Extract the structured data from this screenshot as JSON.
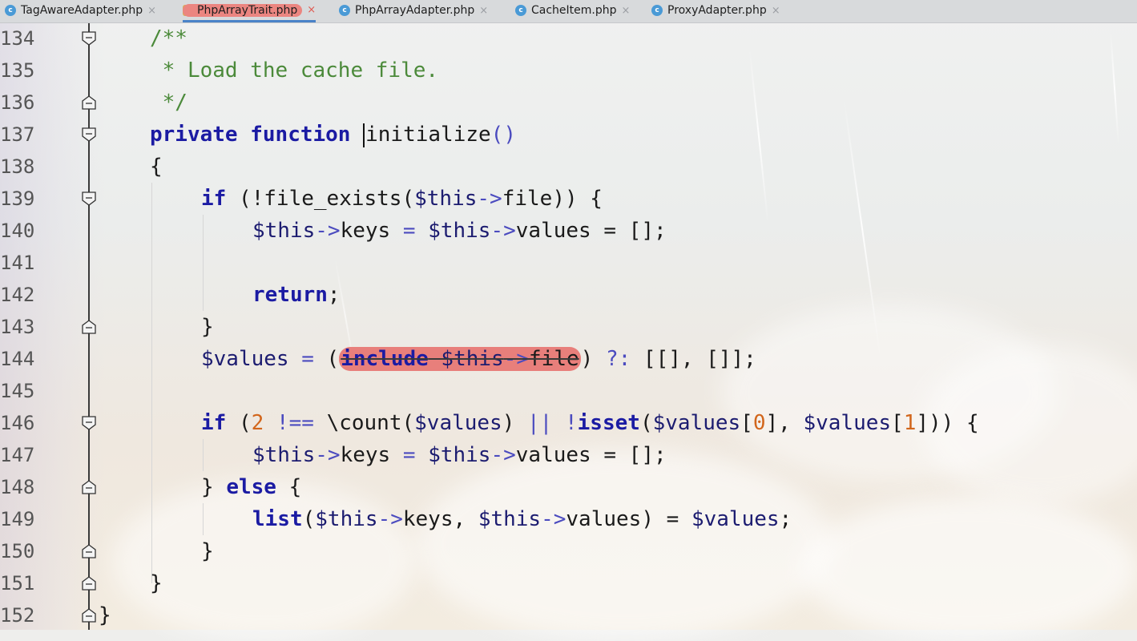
{
  "tabs": [
    {
      "label": "TagAwareAdapter.php",
      "icon": "class-icon"
    },
    {
      "label": "PhpArrayTrait.php",
      "icon": "trait-icon"
    },
    {
      "label": "PhpArrayAdapter.php",
      "icon": "class-icon"
    },
    {
      "label": "CacheItem.php",
      "icon": "class-icon"
    },
    {
      "label": "ProxyAdapter.php",
      "icon": "class-icon"
    }
  ],
  "tab_close_glyph": "×",
  "active_tab": "PhpArrayTrait.php",
  "colors": {
    "keyword": "#1b1ba3",
    "comment": "#4b8a3a",
    "number": "#d2661c",
    "error_highlight": "#e87f7b",
    "active_tab_underline": "#4a83c8"
  },
  "editor": {
    "lines": [
      {
        "n": "134",
        "fold": "open"
      },
      {
        "n": "135",
        "fold": "none"
      },
      {
        "n": "136",
        "fold": "close"
      },
      {
        "n": "137",
        "fold": "open"
      },
      {
        "n": "138",
        "fold": "none"
      },
      {
        "n": "139",
        "fold": "open"
      },
      {
        "n": "140",
        "fold": "none"
      },
      {
        "n": "141",
        "fold": "none"
      },
      {
        "n": "142",
        "fold": "none"
      },
      {
        "n": "143",
        "fold": "close"
      },
      {
        "n": "144",
        "fold": "none"
      },
      {
        "n": "145",
        "fold": "none"
      },
      {
        "n": "146",
        "fold": "open"
      },
      {
        "n": "147",
        "fold": "none"
      },
      {
        "n": "148",
        "fold": "close"
      },
      {
        "n": "149",
        "fold": "none"
      },
      {
        "n": "150",
        "fold": "close"
      },
      {
        "n": "151",
        "fold": "close"
      },
      {
        "n": "152",
        "fold": "close"
      }
    ],
    "code": {
      "l134": "/**",
      "l135": " * Load the cache file.",
      "l136": " */",
      "l137_kw1": "private",
      "l137_kw2": "function",
      "l137_name": "initialize",
      "l137_parens": "()",
      "l138": "{",
      "l139_if": "if",
      "l139_a": " (!file_exists(",
      "l139_this": "$this",
      "l139_arrow": "->",
      "l139_b": "file)) {",
      "l140_this1": "$this",
      "l140_arrow1": "->",
      "l140_keys": "keys",
      "l140_eq1": " = ",
      "l140_this2": "$this",
      "l140_arrow2": "->",
      "l140_values": "values",
      "l140_rest": " = [];",
      "l142_return": "return",
      "l142_semi": ";",
      "l143": "}",
      "l144_var": "$values",
      "l144_eq": " = ",
      "l144_open": "(",
      "l144_include": "include",
      "l144_this": " $this",
      "l144_arrow": "->",
      "l144_file": "file",
      "l144_close": ")",
      "l144_elvis": " ?: ",
      "l144_rest": "[[], []];",
      "l146_if": "if",
      "l146_a": " (",
      "l146_two": "2",
      "l146_neq": " !== ",
      "l146_count": "\\count(",
      "l146_v1": "$values",
      "l146_b": ") ",
      "l146_or": "||",
      "l146_not": " !",
      "l146_isset": "isset",
      "l146_c": "(",
      "l146_v2": "$values",
      "l146_d": "[",
      "l146_zero": "0",
      "l146_e": "], ",
      "l146_v3": "$values",
      "l146_f": "[",
      "l146_one": "1",
      "l146_g": "])) {",
      "l147_this1": "$this",
      "l147_arrow1": "->",
      "l147_keys": "keys",
      "l147_eq1": " = ",
      "l147_this2": "$this",
      "l147_arrow2": "->",
      "l147_values": "values",
      "l147_rest": " = [];",
      "l148_a": "} ",
      "l148_else": "else",
      "l148_b": " {",
      "l149_list": "list",
      "l149_a": "(",
      "l149_this1": "$this",
      "l149_arrow1": "->",
      "l149_keys": "keys",
      "l149_b": ", ",
      "l149_this2": "$this",
      "l149_arrow2": "->",
      "l149_values": "values",
      "l149_c": ") = ",
      "l149_var": "$values",
      "l149_d": ";",
      "l150": "}",
      "l151": "}",
      "l152": "}"
    }
  }
}
